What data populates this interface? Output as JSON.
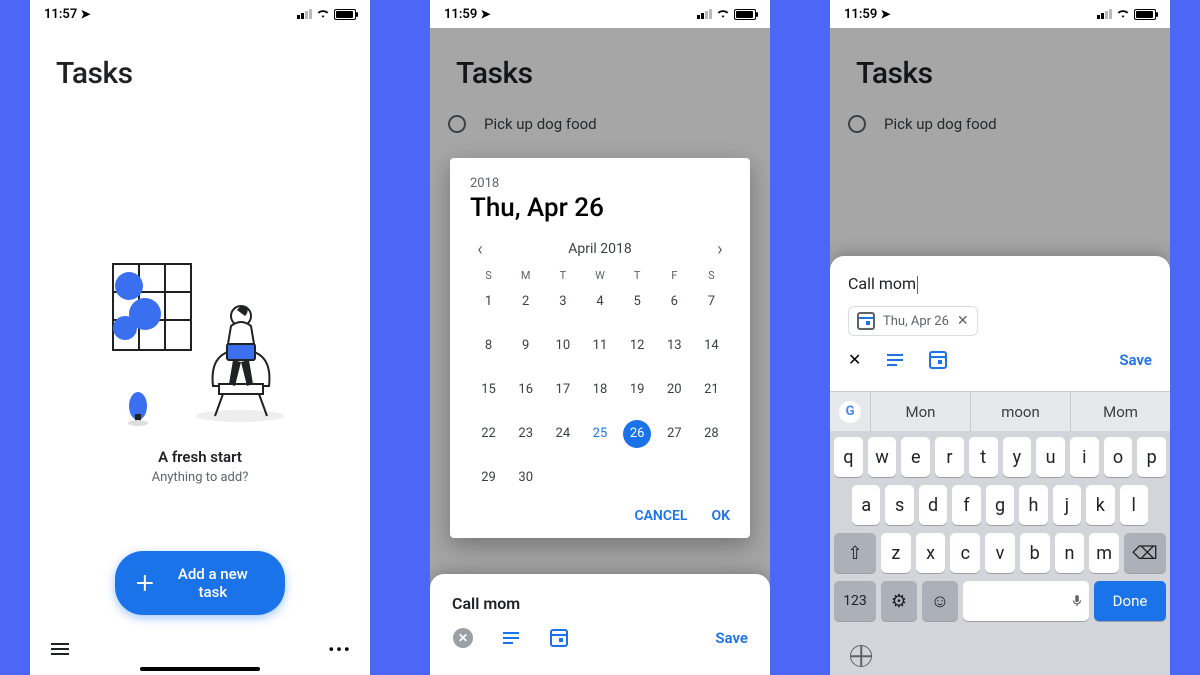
{
  "screen1": {
    "status_time": "11:57",
    "header": "Tasks",
    "empty_title": "A fresh start",
    "empty_sub": "Anything to add?",
    "fab": "Add a new task"
  },
  "screen2": {
    "status_time": "11:59",
    "header": "Tasks",
    "task1": "Pick up dog food",
    "sheet_title": "Call mom",
    "sheet_save": "Save",
    "dialog": {
      "year": "2018",
      "bigdate": "Thu, Apr 26",
      "month": "April 2018",
      "dow": [
        "S",
        "M",
        "T",
        "W",
        "T",
        "F",
        "S"
      ],
      "today": 25,
      "selected": 26,
      "last_day": 30,
      "cancel": "CANCEL",
      "ok": "OK"
    }
  },
  "screen3": {
    "status_time": "11:59",
    "header": "Tasks",
    "task1": "Pick up dog food",
    "input_value": "Call mom",
    "chip": "Thu, Apr 26",
    "save": "Save",
    "suggestions": [
      "Mon",
      "moon",
      "Mom"
    ],
    "keyboard": {
      "row1": [
        "q",
        "w",
        "e",
        "r",
        "t",
        "y",
        "u",
        "i",
        "o",
        "p"
      ],
      "row2": [
        "a",
        "s",
        "d",
        "f",
        "g",
        "h",
        "j",
        "k",
        "l"
      ],
      "row3": [
        "z",
        "x",
        "c",
        "v",
        "b",
        "n",
        "m"
      ],
      "sym": "123",
      "done": "Done"
    }
  }
}
